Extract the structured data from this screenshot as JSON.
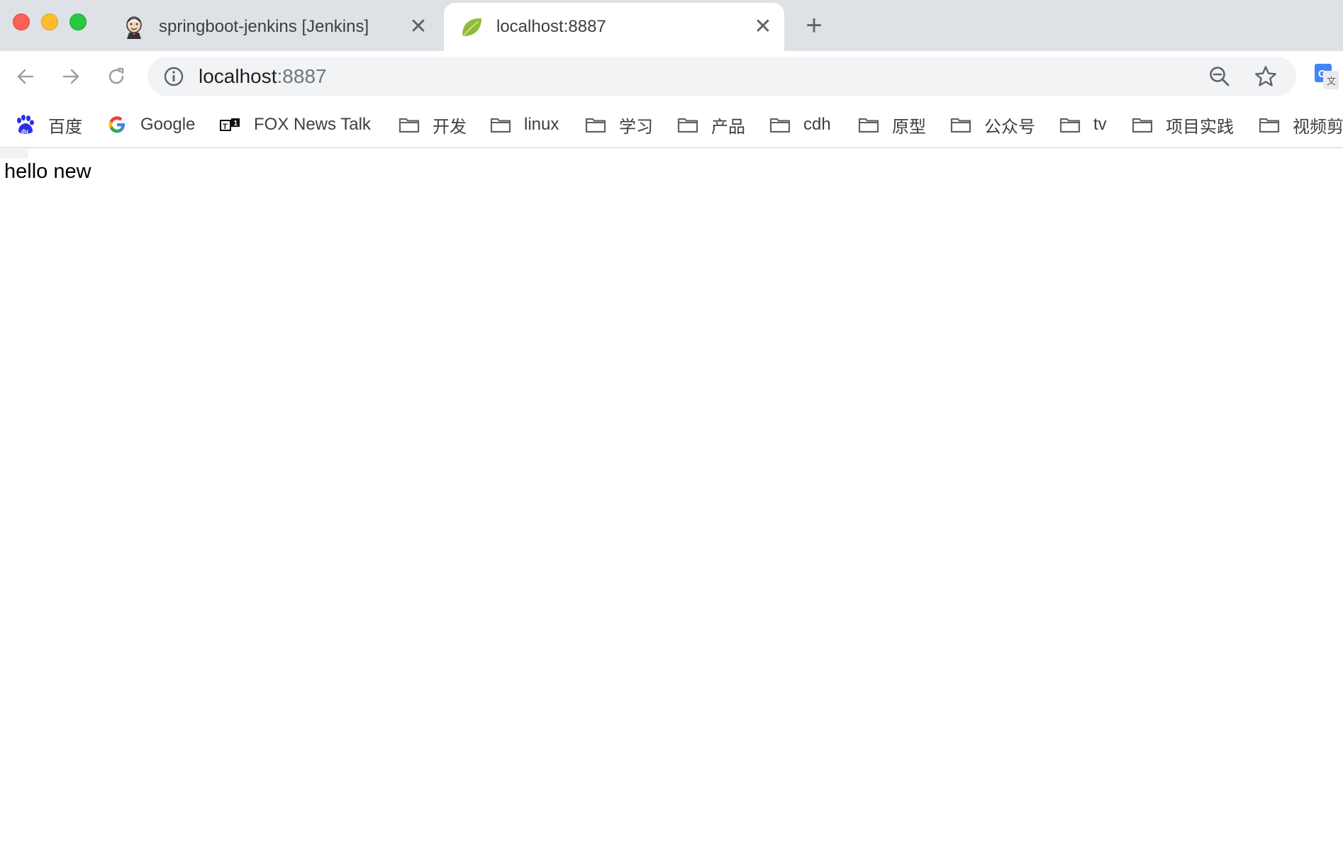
{
  "tabs": [
    {
      "title": "springboot-jenkins [Jenkins]",
      "icon": "jenkins-icon",
      "active": false
    },
    {
      "title": "localhost:8887",
      "icon": "spring-leaf-icon",
      "active": true
    }
  ],
  "toolbar": {
    "url_host": "localhost",
    "url_port": ":8887"
  },
  "bookmarks": [
    {
      "label": "百度",
      "icon": "baidu-icon"
    },
    {
      "label": "Google",
      "icon": "google-icon"
    },
    {
      "label": "FOX News Talk",
      "icon": "fox-news-talk-icon"
    },
    {
      "label": "开发",
      "icon": "folder-icon"
    },
    {
      "label": "linux",
      "icon": "folder-icon"
    },
    {
      "label": "学习",
      "icon": "folder-icon"
    },
    {
      "label": "产品",
      "icon": "folder-icon"
    },
    {
      "label": "cdh",
      "icon": "folder-icon"
    },
    {
      "label": "原型",
      "icon": "folder-icon"
    },
    {
      "label": "公众号",
      "icon": "folder-icon"
    },
    {
      "label": "tv",
      "icon": "folder-icon"
    },
    {
      "label": "项目实践",
      "icon": "folder-icon"
    },
    {
      "label": "视频剪",
      "icon": "folder-icon"
    }
  ],
  "page": {
    "body_text": "hello new"
  },
  "colors": {
    "tabstrip_bg": "#dee1e6",
    "omnibox_bg": "#f1f3f4",
    "traffic_close": "#ff5f57",
    "traffic_minimize": "#febc2e",
    "traffic_maximize": "#28c840"
  }
}
